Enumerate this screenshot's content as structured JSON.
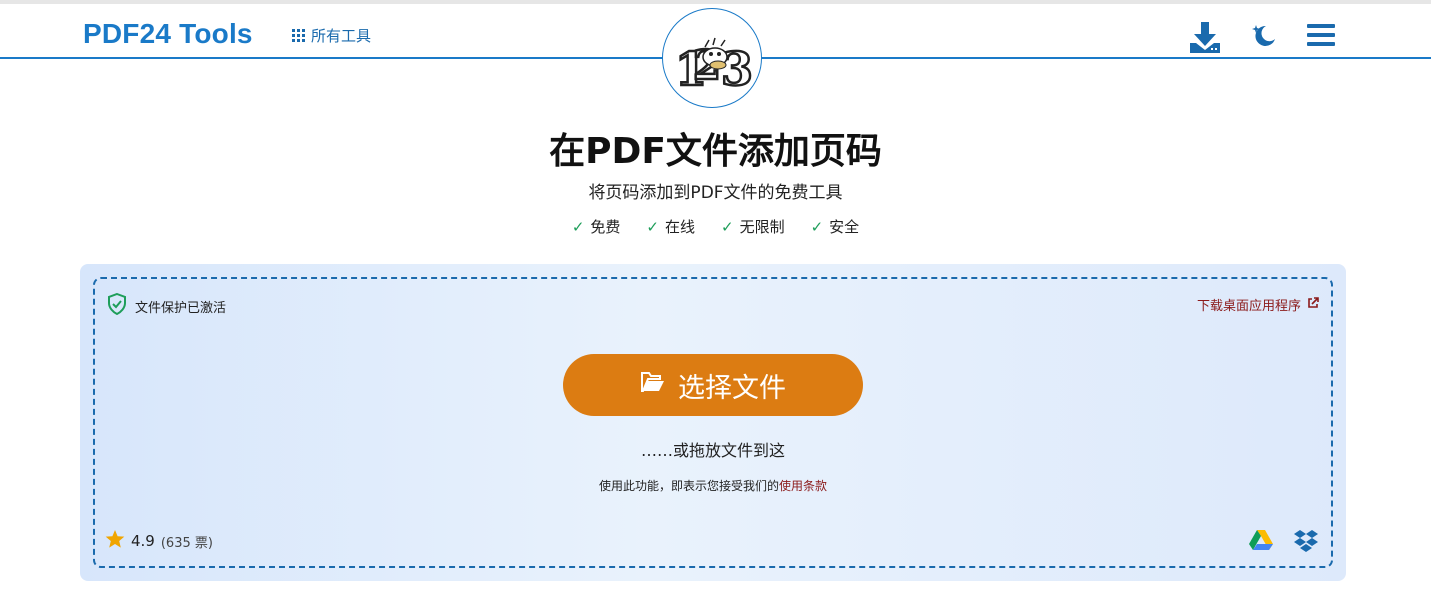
{
  "header": {
    "brand": "PDF24 Tools",
    "all_tools_label": "所有工具"
  },
  "page": {
    "title": "在PDF文件添加页码",
    "subtitle": "将页码添加到PDF文件的免费工具",
    "features": [
      "免费",
      "在线",
      "无限制",
      "安全"
    ]
  },
  "upload": {
    "protection_text": "文件保护已激活",
    "desktop_link": "下载桌面应用程序",
    "choose_button": "选择文件",
    "drop_hint": "……或拖放文件到这",
    "terms_prefix": "使用此功能，即表示您接受我们的",
    "terms_link": "使用条款",
    "rating_value": "4.9",
    "rating_votes": "(635 票)"
  },
  "icons": {
    "menu": "grid-icon",
    "logo": "page-numbers-logo",
    "download": "download-icon",
    "theme": "moon-icon",
    "hamburger": "hamburger-icon",
    "shield": "shield-check-icon",
    "external": "external-link-icon",
    "folder": "folder-open-icon",
    "star": "star-icon",
    "gdrive": "google-drive-icon",
    "dropbox": "dropbox-icon"
  },
  "colors": {
    "brand": "#1a7ac8",
    "button": "#dc7c12",
    "link": "#8b1a1a",
    "check": "#1e9e5a",
    "star": "#f0a500"
  }
}
